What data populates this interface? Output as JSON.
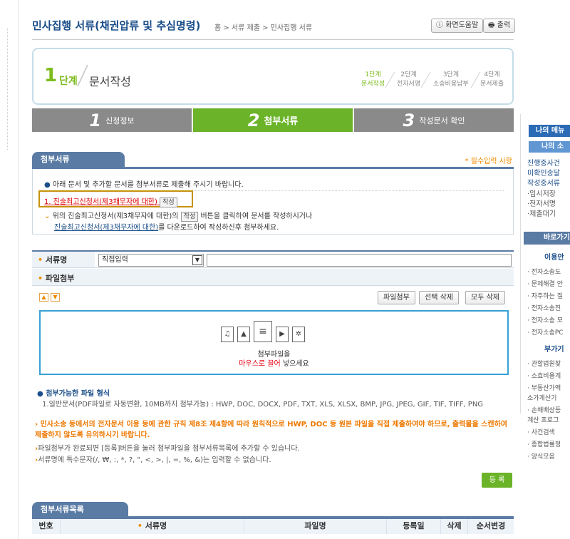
{
  "page": {
    "title": "민사집행 서류(채권압류 및 추심명령)",
    "breadcrumb": "홈 > 서류 제출 > 민사집행 서류",
    "help_button": "화면도움말",
    "print_button": "출력"
  },
  "step": {
    "number": "1",
    "unit": "단계",
    "name": "문서작성",
    "mini": [
      {
        "title": "1단계",
        "label": "문서작성"
      },
      {
        "title": "2단계",
        "label": "전자서명"
      },
      {
        "title": "3단계",
        "label": "소송비용납부"
      },
      {
        "title": "4단계",
        "label": "문서제출"
      }
    ]
  },
  "tabs": [
    {
      "num": "1",
      "label": "신청정보"
    },
    {
      "num": "2",
      "label": "첨부서류"
    },
    {
      "num": "3",
      "label": "작성문서 확인"
    }
  ],
  "attach": {
    "title": "첨부서류",
    "required": "* 필수입력 사항",
    "notice": "아래 문서 및 추가할 문서를 첨부서류로 제출해 주시기 바랍니다.",
    "item_no": "1.",
    "item_link": "진술최고신청서(제3채무자에 대한)",
    "write_btn": "작성",
    "guide1_a": "위의 진술최고신청서(제3채무자에 대한)의",
    "guide1_btn": "작성",
    "guide1_b": "버튼을 클릭하여 문서를 작성하시거나",
    "guide2_link": "진술최고신청서(제3채무자에 대한)",
    "guide2_b": "를 다운로드하여 작성하신후 첨부하세요."
  },
  "docname": {
    "label": "서류명",
    "select_value": "직접입력",
    "text_value": ""
  },
  "fileattach": {
    "label": "파일첨부",
    "btn_attach": "파일첨부",
    "btn_del_sel": "선택 삭제",
    "btn_del_all": "모두 삭제",
    "drop_line1": "첨부파일을",
    "drop_line2_red": "마우스로 끌어",
    "drop_line2_tail": "넣으세요",
    "up": "▲",
    "down": "▼"
  },
  "formats": {
    "title": "첨부가능한 파일 형식",
    "list": "1.일반문서(PDF파일로 자동변환, 10MB까지 첨부가능) : HWP, DOC, DOCX, PDF, TXT, XLS, XLSX, BMP, JPG, JPEG, GIF, TIF, TIFF, PNG"
  },
  "warnings": {
    "warn": "민사소송 등에서의 전자문서 이용 등에 관한 규칙 제8조 제4항에 따라 원칙적으로 HWP, DOC 등 원본 파일을 직접 제출하여야 하므로, 출력물을 스캔하여 제출하지 않도록 유의하시기 바랍니다.",
    "note1": "파일첨부가 완료되면 [등록]버튼을 눌러 첨부파일을 첨부서류목록에 추가할 수 있습니다.",
    "note2": "서류명에 특수문자(/, ₩, :, *, ?, \", <, >, |, =, %, &)는 입력할 수 없습니다."
  },
  "register_btn": "등 록",
  "list": {
    "title": "첨부서류목록",
    "cols": [
      "번호",
      "서류명",
      "파일명",
      "등록일",
      "삭제",
      "순서변경"
    ]
  },
  "right": {
    "my_menu": "나의 메뉴",
    "my_so": "나의 소",
    "links": [
      "진행중사건",
      "미확인송달",
      "작성중서류"
    ],
    "subs": [
      "·임시저장",
      "·전자서명",
      "·제출대기"
    ],
    "goto": "바로가기",
    "cat1": "이용안",
    "cat1_items": [
      "· 전자소송도",
      "· 문제해결 안",
      "· 자주하는 질",
      "· 전자소송진",
      "· 전자소송 모",
      "· 전자소송PC"
    ],
    "cat2": "부가기",
    "cat2_items": [
      "· 관할법원찾",
      "· 소효비용계",
      "· 부동산가액",
      "소가계산기",
      "· 손해배상등",
      "계산 프로그",
      "· 사건검색",
      "· 종합법률정",
      "· 양식모음"
    ]
  },
  "icons": [
    "music-file-icon",
    "image-file-icon",
    "document-file-icon",
    "video-file-icon",
    "other-file-icon",
    "help-icon",
    "printer-icon"
  ]
}
